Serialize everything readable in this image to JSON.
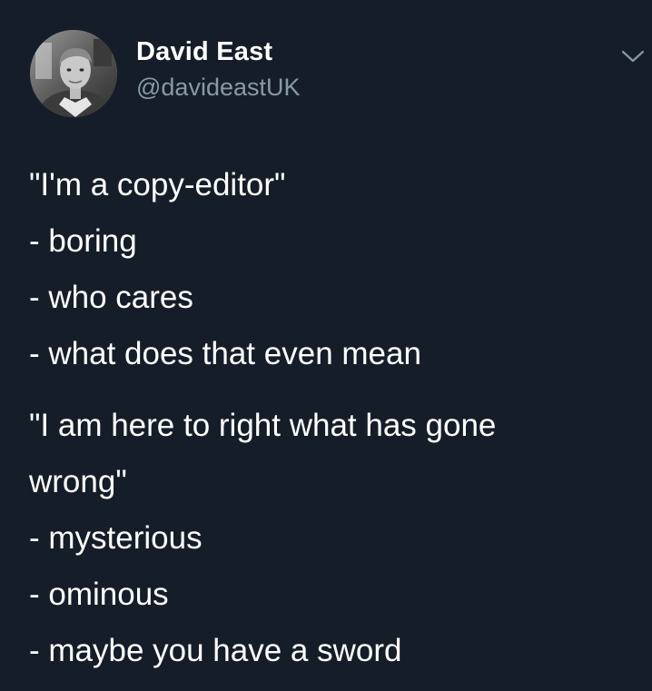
{
  "author": {
    "display_name": "David East",
    "handle": "@davideastUK"
  },
  "icons": {
    "avatar": "profile-photo",
    "menu": "chevron-down-icon"
  },
  "colors": {
    "background": "#151E28",
    "text": "#FFFFFF",
    "secondary_text": "#8899A6"
  },
  "tweet": {
    "lines": [
      "\"I'm a copy-editor\"",
      "- boring",
      "- who cares",
      "- what does that even mean",
      "\"I am here to right what has gone",
      "wrong\"",
      "- mysterious",
      "- ominous",
      "- maybe you have a sword"
    ]
  }
}
